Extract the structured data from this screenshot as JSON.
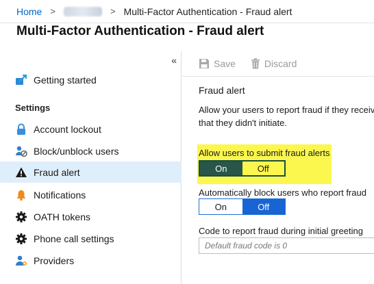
{
  "breadcrumb": {
    "home": "Home",
    "current": "Multi-Factor Authentication - Fraud alert"
  },
  "page_title": "Multi-Factor Authentication - Fraud alert",
  "sidebar": {
    "collapse_glyph": "«",
    "section_label": "Settings",
    "items": [
      {
        "label": "Getting started",
        "icon": "getting-started-icon"
      },
      {
        "label": "Account lockout",
        "icon": "lock-icon"
      },
      {
        "label": "Block/unblock users",
        "icon": "block-users-icon"
      },
      {
        "label": "Fraud alert",
        "icon": "warning-icon",
        "active": true
      },
      {
        "label": "Notifications",
        "icon": "bell-icon"
      },
      {
        "label": "OATH tokens",
        "icon": "gear-icon"
      },
      {
        "label": "Phone call settings",
        "icon": "gear-icon"
      },
      {
        "label": "Providers",
        "icon": "providers-icon"
      }
    ]
  },
  "toolbar": {
    "save_label": "Save",
    "discard_label": "Discard"
  },
  "main": {
    "section_title": "Fraud alert",
    "description_line1": "Allow your users to report fraud if they receiv",
    "description_line2": "that they didn't initiate.",
    "allow_fraud": {
      "label": "Allow users to submit fraud alerts",
      "on": "On",
      "off": "Off",
      "selected": "On"
    },
    "auto_block": {
      "label": "Automatically block users who report fraud",
      "on": "On",
      "off": "Off",
      "selected": "Off"
    },
    "code": {
      "label": "Code to report fraud during initial greeting",
      "placeholder": "Default fraud code is 0"
    }
  },
  "colors": {
    "accent": "#1864d4",
    "highlight": "#fbf74f",
    "active_bg": "#dfeefb",
    "selected_dark": "#285749"
  }
}
